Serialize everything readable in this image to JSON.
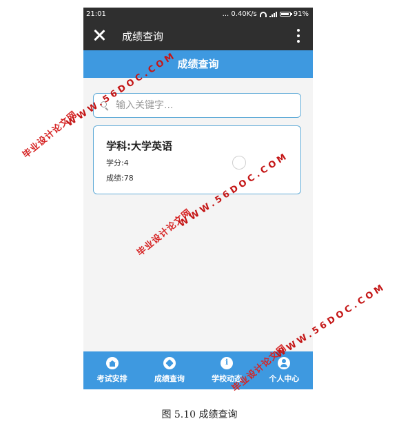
{
  "status_bar": {
    "time": "21:01",
    "network": "... 0.40K/s",
    "battery": "91%",
    "battery_level": 0.91
  },
  "titlebar": {
    "title": "成绩查询"
  },
  "page_header": {
    "title": "成绩查询"
  },
  "search": {
    "placeholder": "输入关键字..."
  },
  "result_card": {
    "subject": "学科:大学英语",
    "credit": "学分:4",
    "score": "成绩:78"
  },
  "tabbar": {
    "items": [
      {
        "label": "考试安排",
        "icon": "home-icon"
      },
      {
        "label": "成绩查询",
        "icon": "tag-icon"
      },
      {
        "label": "学校动态",
        "icon": "info-icon"
      },
      {
        "label": "个人中心",
        "icon": "person-icon"
      }
    ]
  },
  "caption": "图 5.10 成绩查询",
  "watermarks": {
    "cn": "毕业设计论文网",
    "url": "WWW.56DOC.COM"
  },
  "colors": {
    "accent": "#3e99e0",
    "titlebar": "#2f2f2f",
    "card_border": "#62acd8",
    "watermark": "#d62424"
  }
}
